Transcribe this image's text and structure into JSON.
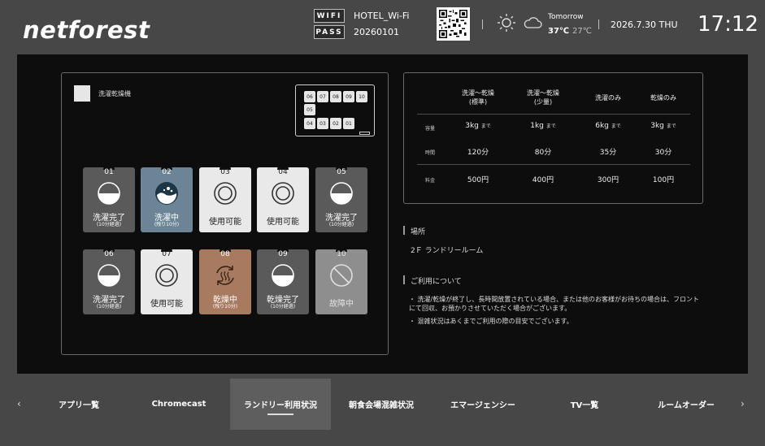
{
  "header": {
    "logo": "netforest",
    "wifi_tag": "WIFI",
    "wifi_ssid": "HOTEL_Wi-Fi",
    "pass_tag": "PASS",
    "wifi_pass": "20260101",
    "weather_label": "Tomorrow",
    "temp_high": "37℃",
    "temp_low": "27℃",
    "date": "2026.7.30 THU",
    "time": "17:12"
  },
  "legend": {
    "label": "洗濯乾燥機"
  },
  "minimap": {
    "cells": [
      "06",
      "07",
      "08",
      "09",
      "10",
      "05",
      "04",
      "03",
      "02",
      "01"
    ]
  },
  "machines": [
    {
      "num": "01",
      "status": "洗濯完了",
      "sub": "(10分経過)",
      "state": "done"
    },
    {
      "num": "02",
      "status": "洗濯中",
      "sub": "(残り10分)",
      "state": "washing"
    },
    {
      "num": "03",
      "status": "使用可能",
      "sub": "",
      "state": "free"
    },
    {
      "num": "04",
      "status": "使用可能",
      "sub": "",
      "state": "free"
    },
    {
      "num": "05",
      "status": "洗濯完了",
      "sub": "(10分経過)",
      "state": "done"
    },
    {
      "num": "06",
      "status": "洗濯完了",
      "sub": "(10分経過)",
      "state": "done"
    },
    {
      "num": "07",
      "status": "使用可能",
      "sub": "",
      "state": "free"
    },
    {
      "num": "08",
      "status": "乾燥中",
      "sub": "(残り10分)",
      "state": "drying"
    },
    {
      "num": "09",
      "status": "乾燥完了",
      "sub": "(10分経過)",
      "state": "done"
    },
    {
      "num": "10",
      "status": "故障中",
      "sub": "",
      "state": "broken"
    }
  ],
  "price_table": {
    "headers": [
      "洗濯～乾燥\n(標準)",
      "洗濯～乾燥\n(少量)",
      "洗濯のみ",
      "乾燥のみ"
    ],
    "rows": [
      {
        "label": "容量",
        "values": [
          "3kg",
          "1kg",
          "6kg",
          "3kg"
        ],
        "suffix": "まで"
      },
      {
        "label": "時間",
        "values": [
          "120分",
          "80分",
          "35分",
          "30分"
        ],
        "suffix": ""
      },
      {
        "label": "料金",
        "values": [
          "500円",
          "400円",
          "300円",
          "100円"
        ],
        "suffix": ""
      }
    ]
  },
  "location": {
    "title": "場所",
    "text": "2Ｆ ランドリールーム"
  },
  "usage": {
    "title": "ご利用について",
    "notes": [
      "洗濯/乾燥が終了し、長時間放置されている場合、または他のお客様がお待ちの場合は、フロントにて回収、お預かりさせていただく場合がございます。",
      "混雑状況はあくまでご利用の際の目安でございます。"
    ]
  },
  "nav": {
    "prev": "‹",
    "next": "›",
    "items": [
      "アプリ一覧",
      "Chromecast",
      "ランドリー利用状況",
      "朝食会場混雑状況",
      "エマージェンシー",
      "TV一覧",
      "ルームオーダー"
    ],
    "active_index": 2
  }
}
